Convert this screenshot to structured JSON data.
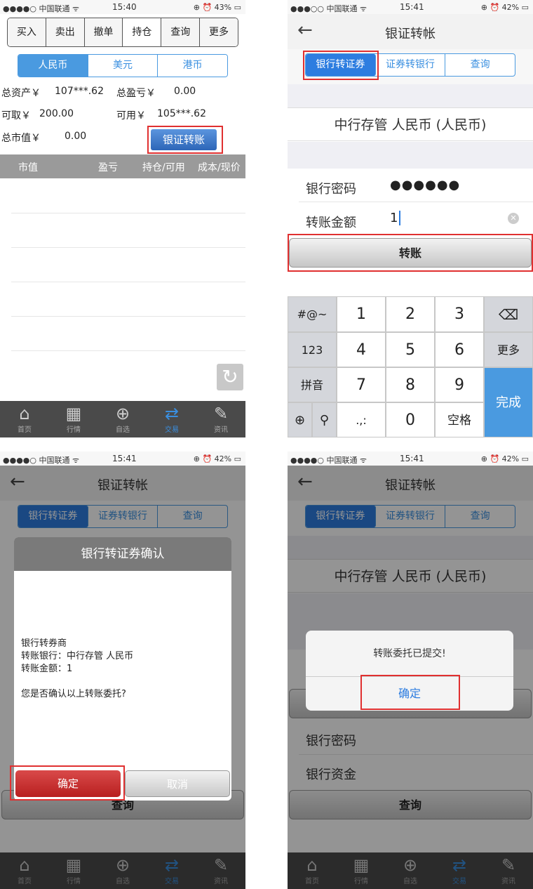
{
  "p1": {
    "status": {
      "carrier": "●●●●○ 中国联通 ᯤ",
      "time": "15:40",
      "right": "⊕ ⏰ 43% ▭"
    },
    "top_tabs": [
      "买入",
      "卖出",
      "撤单",
      "持仓",
      "查询",
      "更多"
    ],
    "currency_tabs": [
      "人民币",
      "美元",
      "港币"
    ],
    "assets": {
      "total_label": "总资产￥",
      "total_value": "107***.62",
      "pnl_label": "总盈亏￥",
      "pnl_value": "0.00",
      "withdraw_label": "可取￥",
      "withdraw_value": "200.00",
      "available_label": "可用￥",
      "available_value": "105***.62",
      "market_label": "总市值￥",
      "market_value": "0.00"
    },
    "transfer_button": "银证转账",
    "table_headers": [
      "市值",
      "盈亏",
      "持仓/可用",
      "成本/现价"
    ],
    "nav": [
      "首页",
      "行情",
      "自选",
      "交易",
      "资讯"
    ]
  },
  "p2": {
    "status": {
      "carrier": "●●●○○ 中国联通 ᯤ",
      "time": "15:41",
      "right": "⊕ ⏰ 42% ▭"
    },
    "title": "银证转帐",
    "sub_tabs": [
      "银行转证券",
      "证券转银行",
      "查询"
    ],
    "bank": "中行存管 人民币 (人民币)",
    "password_label": "银行密码",
    "password_value": "●●●●●●",
    "amount_label": "转账金额",
    "amount_value": "1",
    "submit": "转账",
    "keyboard": {
      "symbols": "#@~",
      "num123": "123",
      "pinyin": "拼音",
      "punct": ".,:",
      "digits": [
        "1",
        "2",
        "3",
        "4",
        "5",
        "6",
        "7",
        "8",
        "9",
        "0"
      ],
      "more": "更多",
      "space": "空格",
      "done": "完成"
    }
  },
  "p3": {
    "status": {
      "carrier": "●●●●○ 中国联通 ᯤ",
      "time": "15:41",
      "right": "⊕ ⏰ 42% ▭"
    },
    "title": "银证转帐",
    "sub_tabs": [
      "银行转证券",
      "证券转银行",
      "查询"
    ],
    "dialog_title": "银行转证券确认",
    "lines": [
      "银行转券商",
      "转账银行：中行存管 人民币",
      "转账金额：1"
    ],
    "question": "您是否确认以上转账委托?",
    "ok": "确定",
    "cancel": "取消",
    "behind_button": "查询",
    "nav": [
      "首页",
      "行情",
      "自选",
      "交易",
      "资讯"
    ]
  },
  "p4": {
    "status": {
      "carrier": "●●●●○ 中国联通 ᯤ",
      "time": "15:41",
      "right": "⊕ ⏰ 42% ▭"
    },
    "title": "银证转帐",
    "sub_tabs": [
      "银行转证券",
      "证券转银行",
      "查询"
    ],
    "bank": "中行存管 人民币 (人民币)",
    "alert_msg": "转账委托已提交!",
    "alert_ok": "确定",
    "password_label": "银行密码",
    "funds_label": "银行资金",
    "query_button": "查询",
    "nav": [
      "首页",
      "行情",
      "自选",
      "交易",
      "资讯"
    ]
  },
  "colors": {
    "accent": "#4a9ae0",
    "highlight": "#e03030",
    "confirm": "#c62828"
  }
}
